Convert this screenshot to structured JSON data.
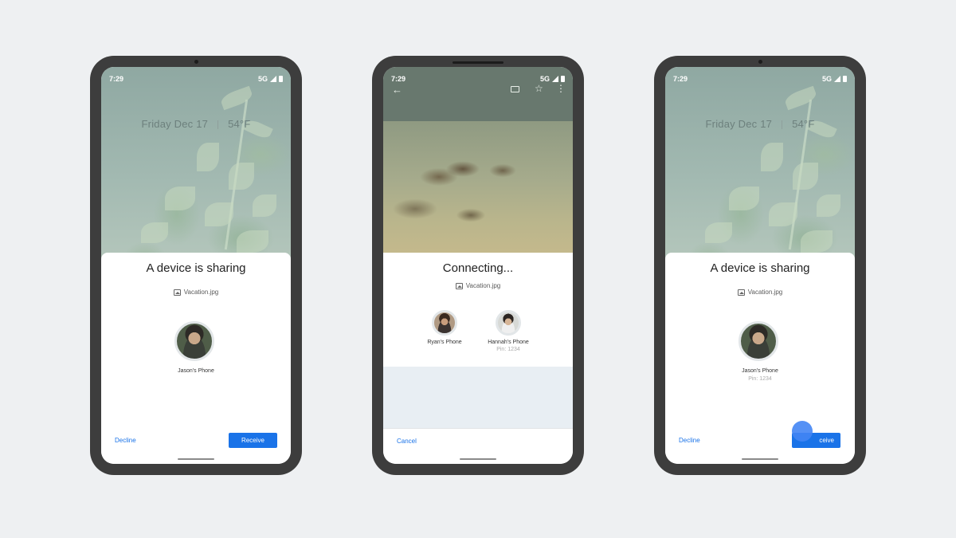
{
  "screens": [
    {
      "status_time": "7:29",
      "status_network": "5G",
      "lock_date": "Friday Dec 17",
      "lock_temp": "54°F",
      "sheet_title": "A device is sharing",
      "file_name": "Vacation.jpg",
      "device_name": "Jason's Phone",
      "decline_label": "Decline",
      "receive_label": "Receive"
    },
    {
      "status_time": "7:29",
      "status_network": "5G",
      "sheet_title": "Connecting...",
      "file_name": "Vacation.jpg",
      "devices": [
        {
          "name": "Ryan's Phone",
          "pin": ""
        },
        {
          "name": "Hannah's Phone",
          "pin": "Pin: 1234"
        }
      ],
      "cancel_label": "Cancel"
    },
    {
      "status_time": "7:29",
      "status_network": "5G",
      "lock_date": "Friday Dec 17",
      "lock_temp": "54°F",
      "sheet_title": "A device is sharing",
      "file_name": "Vacation.jpg",
      "device_name": "Jason's Phone",
      "device_pin": "Pin: 1234",
      "decline_label": "Decline",
      "receive_label": "Receive",
      "receive_label_visible": "ceive"
    }
  ],
  "colors": {
    "accent": "#1a73e8",
    "phone_frame": "#3d3d3d",
    "background": "#eef0f2"
  }
}
